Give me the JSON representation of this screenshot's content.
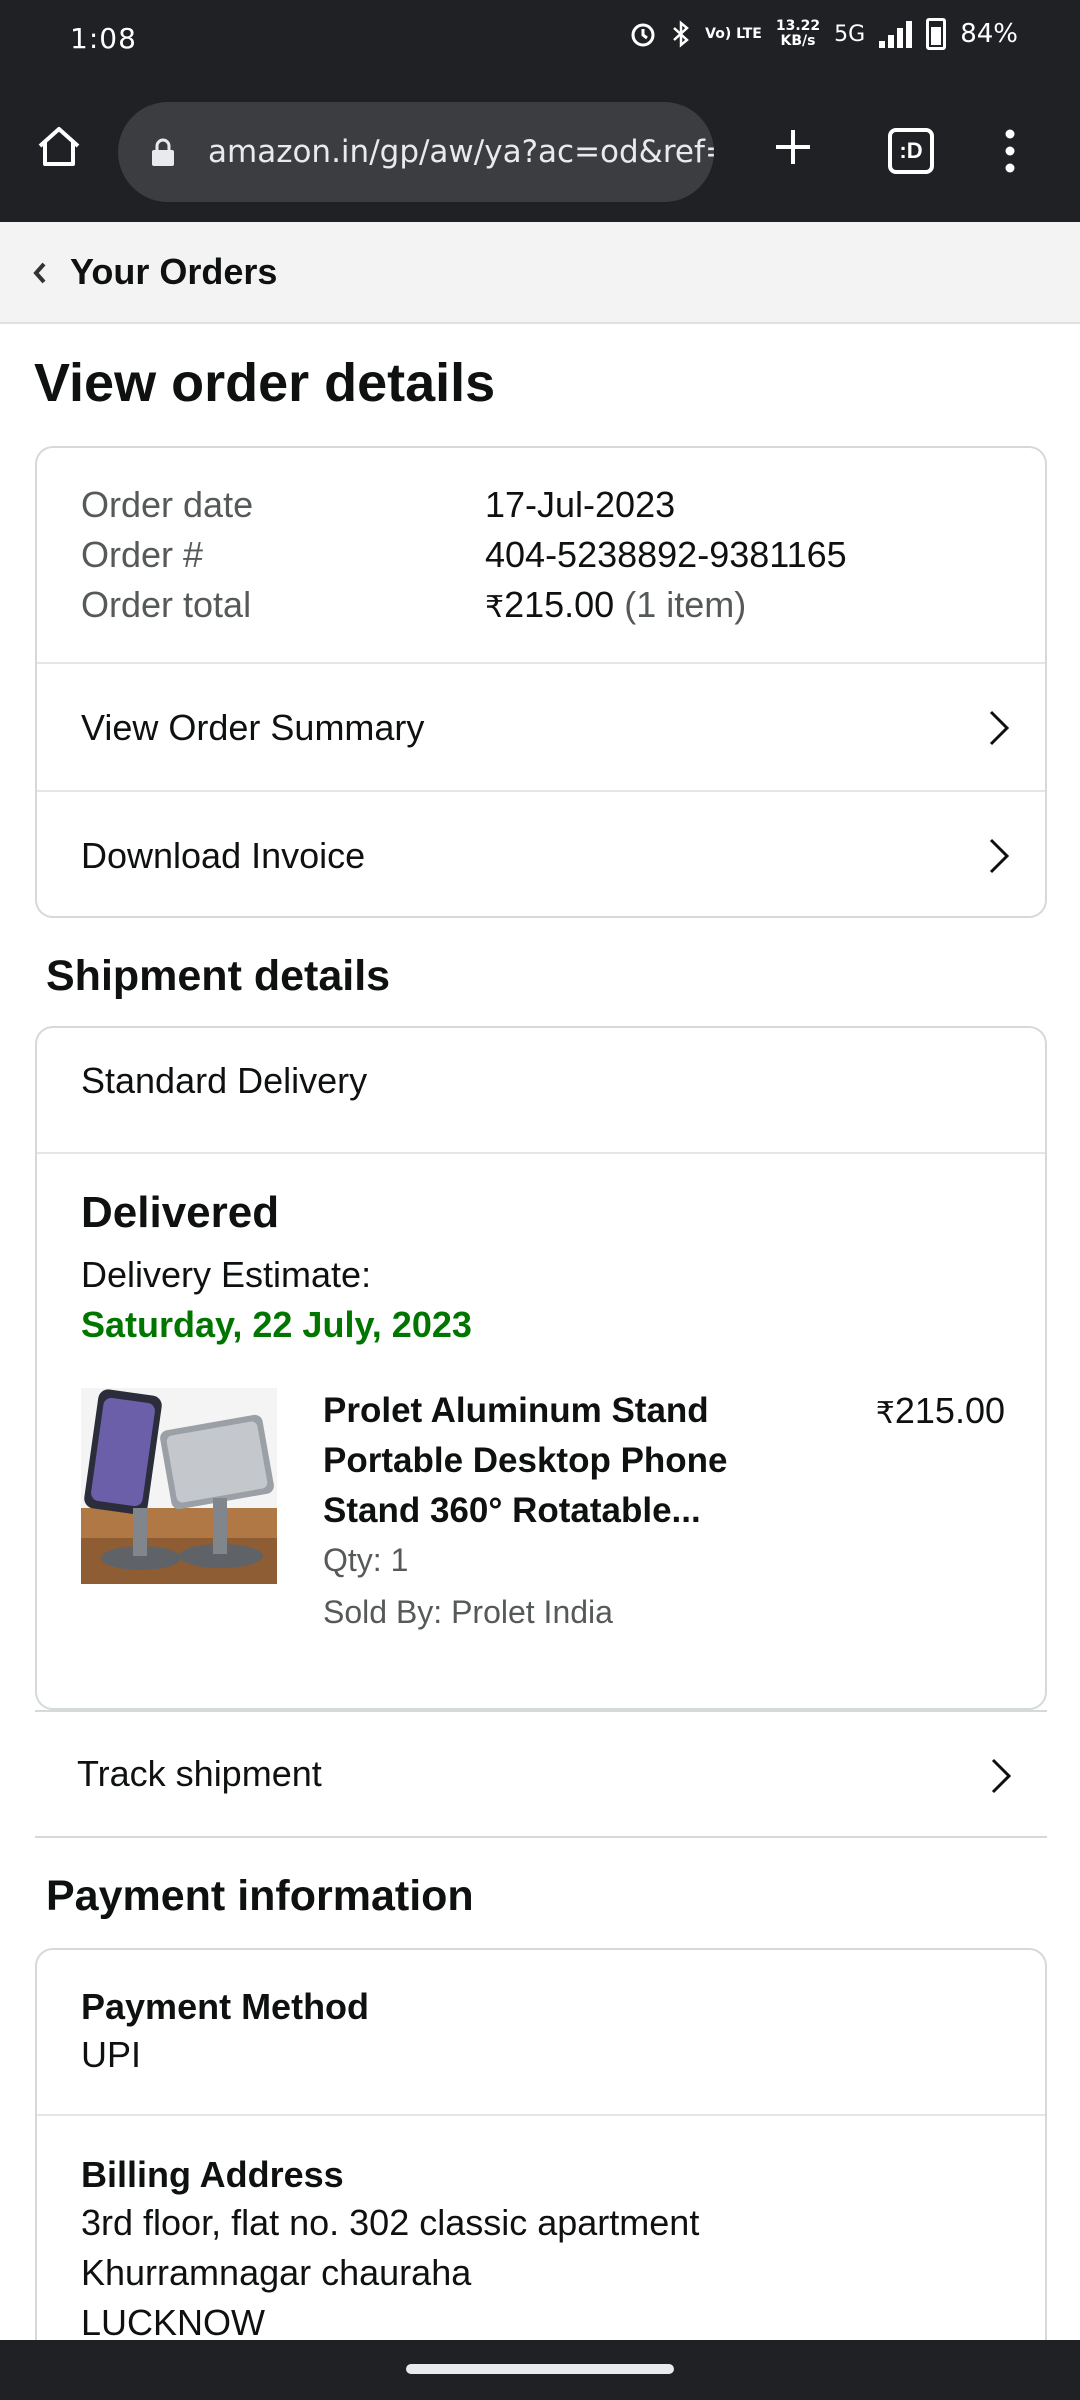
{
  "status_bar": {
    "time": "1:08",
    "volte": "Vo) LTE",
    "speed_value": "13.22",
    "speed_unit": "KB/s",
    "network": "5G",
    "battery": "84%"
  },
  "browser": {
    "url": "amazon.in/gp/aw/ya?ac=od&ref=p",
    "tabs_label": ":D"
  },
  "subnav": {
    "back_label": "Your Orders"
  },
  "page": {
    "title": "View order details"
  },
  "order": {
    "date_label": "Order date",
    "date_value": "17-Jul-2023",
    "number_label": "Order #",
    "number_value": "404-5238892-9381165",
    "total_label": "Order total",
    "currency": "₹",
    "total_value": "215.00",
    "total_items": "(1 item)",
    "view_summary": "View Order Summary",
    "download_invoice": "Download Invoice"
  },
  "shipment": {
    "heading": "Shipment details",
    "delivery_type": "Standard Delivery",
    "status": "Delivered",
    "estimate_label": "Delivery Estimate:",
    "estimate_date": "Saturday, 22 July, 2023",
    "product": {
      "name": "Prolet Aluminum Stand Portable Desktop Phone Stand 360° Rotatable...",
      "currency": "₹",
      "price": "215.00",
      "qty": "Qty: 1",
      "sold_by": "Sold By: Prolet India"
    },
    "track_label": "Track shipment"
  },
  "payment": {
    "heading": "Payment information",
    "method_label": "Payment Method",
    "method_value": "UPI",
    "billing_label": "Billing Address",
    "billing_line1": "3rd floor, flat no. 302 classic apartment",
    "billing_line2": "Khurramnagar chauraha",
    "billing_line3": "LUCKNOW"
  },
  "colors": {
    "delivered_green": "#007600",
    "browser_bg": "#202124"
  }
}
